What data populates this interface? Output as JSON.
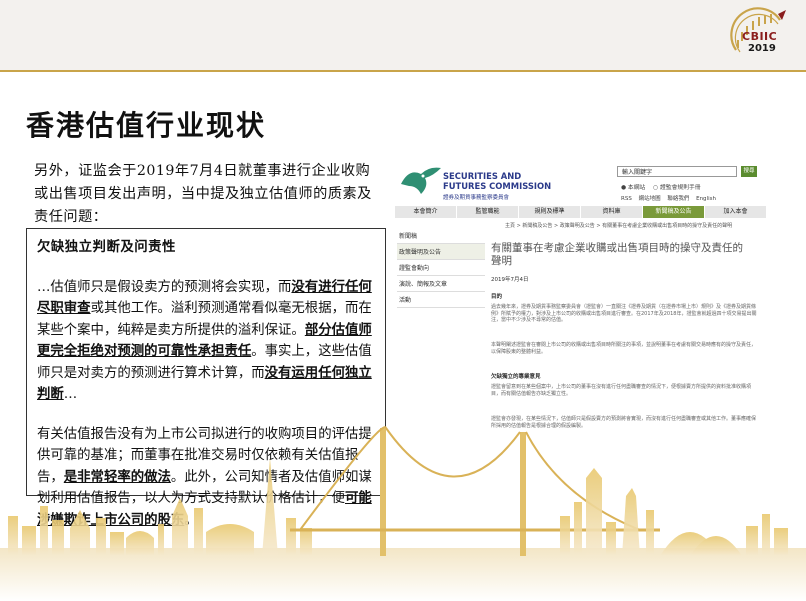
{
  "branding": {
    "logo_text": "CBIIC",
    "logo_year": "2019"
  },
  "slide": {
    "title": "香港估值行业现状",
    "intro": "另外，证监会于2019年7月4日就董事进行企业收购或出售项目发出声明，当中提及独立估值师的质素及责任问题："
  },
  "box": {
    "heading": "欠缺独立判断及问责性",
    "p1": [
      {
        "t": "…估值师只是假设卖方的预测将会实现，而",
        "b": false
      },
      {
        "t": "没有进行任何尽职审查",
        "b": true
      },
      {
        "t": "或其他工作。溢利预测通常看似毫无根据，而在某些个案中，纯粹是卖方所提供的溢利保证。",
        "b": false
      },
      {
        "t": "部分估值师更完全拒绝对预测的可靠性承担责任",
        "b": true
      },
      {
        "t": "。事实上，这些估值师只是对卖方的预测进行算术计算，而",
        "b": false
      },
      {
        "t": "没有运用任何独立判断",
        "b": true
      },
      {
        "t": "…",
        "b": false
      }
    ],
    "p2": [
      {
        "t": "有关估值报告没有为上市公司拟进行的收购项目的评估提供可靠的基准；而董事在批准交易时仅依赖有关估值报告，",
        "b": false
      },
      {
        "t": "是非常轻率的做法",
        "b": true
      },
      {
        "t": "。此外，公司知情者及估值师如谋划利用估值报告，以人为方式支持默认价格估计，便",
        "b": false
      },
      {
        "t": "可能涉嫌欺诈上市公司的股东",
        "b": true
      },
      {
        "t": "。",
        "b": false
      }
    ]
  },
  "web": {
    "org_en_1": "SECURITIES AND",
    "org_en_2": "FUTURES COMMISSION",
    "org_zh": "證券及期貨事務監察委員會",
    "search_placeholder": "輸入關鍵字",
    "search_go": "搜尋",
    "radio_1": "● 本網站",
    "radio_2": "○ 證監會規則手冊",
    "link_1": "RSS",
    "link_2": "網站地圖",
    "link_3": "聯絡我們",
    "link_4": "English",
    "nav": [
      "本會簡介",
      "監管職能",
      "規則及標準",
      "資料庫",
      "新聞稿及公告",
      "加入本會"
    ],
    "nav_active": 4,
    "breadcrumb": "主頁 > 新聞稿及公告 > 政策聲明及公告 > 有關董事在考慮企業收購或出售項目時的操守及責任的聲明",
    "side": [
      "新聞稿",
      "政策聲明及公告",
      "證監會動向",
      "演說、簡報及文章",
      "活動"
    ],
    "side_selected": 1,
    "headline": "有關董事在考慮企業收購或出售項目時的操守及責任的聲明",
    "date": "2019年7月4日",
    "sec_1": "目的",
    "para_1": "過去幾年來，證券及期貨事務監察委員會（證監會）一直關注《證券及期貨（在證券市場上市）規則》及《證券及期貨條例》所賦予的權力，對涉及上市公司的收購或出售項目進行審查。在2017年及2018年，證監會就超過四十項交易提出關注，當中不少涉及不尋常的估值。",
    "para_2": "本聲明闡述證監會在審閱上市公司的收購或出售項目時所關注的事項，並說明董事在考慮有關交易時應有的操守及責任，以保障股東的整體利益。",
    "sec_2": "欠缺獨立的專業意見",
    "para_3": "證監會留意到在某些個案中，上市公司的董事在沒有進行任何盡職審查的情況下，便根據賣方所提供的資料批准收購項目，而有關估值報告亦缺乏獨立性。",
    "para_4": "證監會亦發現，在某些情況下，估值師只是假設賣方的預測將會實現，而沒有進行任何盡職審查或其他工作。董事應確保所採用的估值報告是根據合理的假設編製。"
  }
}
